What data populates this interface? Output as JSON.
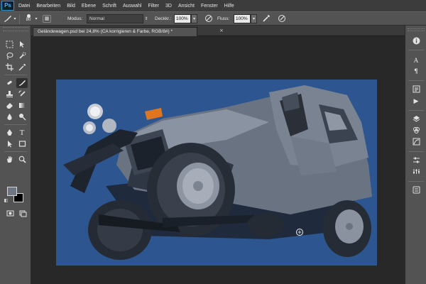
{
  "app": {
    "logo": "Ps"
  },
  "menu": [
    "Datei",
    "Bearbeiten",
    "Bild",
    "Ebene",
    "Schrift",
    "Auswahl",
    "Filter",
    "3D",
    "Ansicht",
    "Fenster",
    "Hilfe"
  ],
  "options": {
    "brush_size": "80",
    "mode_label": "Modus:",
    "mode_value": "Normal",
    "opacity_label": "Deckkr.:",
    "opacity_value": "100%",
    "flow_label": "Fluss:",
    "flow_value": "100%"
  },
  "document": {
    "tab_title": "Geländewagen.psd bei 24,8% (CA korrigieren & Farbe, RGB/8#) *",
    "tab_close": "×",
    "background_color": "#2d5690"
  },
  "toolbar": {
    "foreground_color": "#6e7684",
    "background_color": "#000000",
    "tools": [
      "marquee-tool",
      "move-tool",
      "lasso-tool",
      "quick-selection-tool",
      "crop-tool",
      "eyedropper-tool",
      "spot-healing-tool",
      "brush-tool",
      "clone-stamp-tool",
      "history-brush-tool",
      "eraser-tool",
      "gradient-tool",
      "blur-tool",
      "dodge-tool",
      "pen-tool",
      "type-tool",
      "path-selection-tool",
      "shape-tool",
      "hand-tool",
      "zoom-tool"
    ],
    "selected_tool": "brush-tool"
  },
  "dock": {
    "buttons": [
      "info-panel-icon",
      "character-panel-icon",
      "paragraph-panel-icon",
      "history-panel-icon",
      "actions-panel-icon",
      "layers-panel-icon",
      "channels-panel-icon",
      "paths-panel-icon",
      "adjustments-panel-icon",
      "properties-panel-icon",
      "libraries-panel-icon"
    ]
  }
}
